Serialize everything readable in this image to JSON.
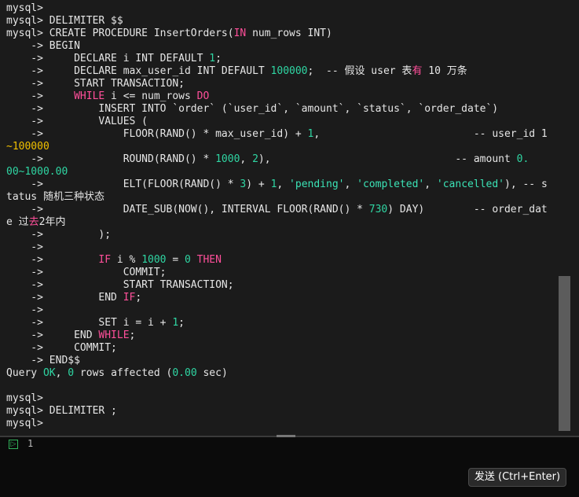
{
  "terminal": {
    "lines": [
      {
        "segments": [
          {
            "t": "mysql>",
            "c": ""
          }
        ]
      },
      {
        "segments": [
          {
            "t": "mysql> DELIMITER $$",
            "c": ""
          }
        ]
      },
      {
        "segments": [
          {
            "t": "mysql> CREATE PROCEDURE InsertOrders(",
            "c": ""
          },
          {
            "t": "IN",
            "c": "kw"
          },
          {
            "t": " num_rows INT)",
            "c": ""
          }
        ]
      },
      {
        "segments": [
          {
            "t": "    -> BEGIN",
            "c": ""
          }
        ]
      },
      {
        "segments": [
          {
            "t": "    ->     DECLARE i INT DEFAULT ",
            "c": ""
          },
          {
            "t": "1",
            "c": "num"
          },
          {
            "t": ";",
            "c": ""
          }
        ]
      },
      {
        "segments": [
          {
            "t": "    ->     DECLARE max_user_id INT DEFAULT ",
            "c": ""
          },
          {
            "t": "100000",
            "c": "num"
          },
          {
            "t": ";  -- 假设 user 表",
            "c": ""
          },
          {
            "t": "有",
            "c": "kw"
          },
          {
            "t": " 10 万条",
            "c": ""
          }
        ]
      },
      {
        "segments": [
          {
            "t": "    ->     START TRANSACTION;",
            "c": ""
          }
        ]
      },
      {
        "segments": [
          {
            "t": "    ->     ",
            "c": ""
          },
          {
            "t": "WHILE",
            "c": "kw"
          },
          {
            "t": " i <= num_rows ",
            "c": ""
          },
          {
            "t": "DO",
            "c": "kw"
          }
        ]
      },
      {
        "segments": [
          {
            "t": "    ->         INSERT INTO `order` (`user_id`, `amount`, `status`, `order_date`)",
            "c": ""
          }
        ]
      },
      {
        "segments": [
          {
            "t": "    ->         VALUES (",
            "c": ""
          }
        ]
      },
      {
        "segments": [
          {
            "t": "    ->             FLOOR(RAND() * max_user_id) + ",
            "c": ""
          },
          {
            "t": "1",
            "c": "num"
          },
          {
            "t": ",                         -- user_id 1",
            "c": ""
          }
        ]
      },
      {
        "segments": [
          {
            "t": "~100000",
            "c": "yel"
          }
        ]
      },
      {
        "segments": [
          {
            "t": "    ->             ROUND(RAND() * ",
            "c": ""
          },
          {
            "t": "1000",
            "c": "num"
          },
          {
            "t": ", ",
            "c": ""
          },
          {
            "t": "2",
            "c": "num"
          },
          {
            "t": "),                              -- amount ",
            "c": ""
          },
          {
            "t": "0.",
            "c": "num"
          }
        ]
      },
      {
        "segments": [
          {
            "t": "00~1000.00",
            "c": "num"
          }
        ]
      },
      {
        "segments": [
          {
            "t": "    ->             ELT(FLOOR(RAND() * ",
            "c": ""
          },
          {
            "t": "3",
            "c": "num"
          },
          {
            "t": ") + ",
            "c": ""
          },
          {
            "t": "1",
            "c": "num"
          },
          {
            "t": ", ",
            "c": ""
          },
          {
            "t": "'pending'",
            "c": "str"
          },
          {
            "t": ", ",
            "c": ""
          },
          {
            "t": "'completed'",
            "c": "str"
          },
          {
            "t": ", ",
            "c": ""
          },
          {
            "t": "'cancelled'",
            "c": "str"
          },
          {
            "t": "), -- s",
            "c": ""
          }
        ]
      },
      {
        "segments": [
          {
            "t": "tatus 随机三种状态",
            "c": ""
          }
        ]
      },
      {
        "segments": [
          {
            "t": "    ->             DATE_SUB(NOW(), INTERVAL FLOOR(RAND() * ",
            "c": ""
          },
          {
            "t": "730",
            "c": "num"
          },
          {
            "t": ") DAY)        -- order_dat",
            "c": ""
          }
        ]
      },
      {
        "segments": [
          {
            "t": "e 过",
            "c": ""
          },
          {
            "t": "去",
            "c": "kw"
          },
          {
            "t": "2年内",
            "c": ""
          }
        ]
      },
      {
        "segments": [
          {
            "t": "    ->         );",
            "c": ""
          }
        ]
      },
      {
        "segments": [
          {
            "t": "    ->",
            "c": ""
          }
        ]
      },
      {
        "segments": [
          {
            "t": "    ->         ",
            "c": ""
          },
          {
            "t": "IF",
            "c": "kw"
          },
          {
            "t": " i % ",
            "c": ""
          },
          {
            "t": "1000",
            "c": "num"
          },
          {
            "t": " = ",
            "c": ""
          },
          {
            "t": "0",
            "c": "num"
          },
          {
            "t": " ",
            "c": ""
          },
          {
            "t": "THEN",
            "c": "kw"
          }
        ]
      },
      {
        "segments": [
          {
            "t": "    ->             COMMIT;",
            "c": ""
          }
        ]
      },
      {
        "segments": [
          {
            "t": "    ->             START TRANSACTION;",
            "c": ""
          }
        ]
      },
      {
        "segments": [
          {
            "t": "    ->         END ",
            "c": ""
          },
          {
            "t": "IF",
            "c": "kw"
          },
          {
            "t": ";",
            "c": ""
          }
        ]
      },
      {
        "segments": [
          {
            "t": "    ->",
            "c": ""
          }
        ]
      },
      {
        "segments": [
          {
            "t": "    ->         SET i = i + ",
            "c": ""
          },
          {
            "t": "1",
            "c": "num"
          },
          {
            "t": ";",
            "c": ""
          }
        ]
      },
      {
        "segments": [
          {
            "t": "    ->     END ",
            "c": ""
          },
          {
            "t": "WHILE",
            "c": "kw"
          },
          {
            "t": ";",
            "c": ""
          }
        ]
      },
      {
        "segments": [
          {
            "t": "    ->     COMMIT;",
            "c": ""
          }
        ]
      },
      {
        "segments": [
          {
            "t": "    -> END$$",
            "c": ""
          }
        ]
      },
      {
        "segments": [
          {
            "t": "Query ",
            "c": ""
          },
          {
            "t": "OK",
            "c": "num"
          },
          {
            "t": ", ",
            "c": ""
          },
          {
            "t": "0",
            "c": "num"
          },
          {
            "t": " rows affected (",
            "c": ""
          },
          {
            "t": "0.00",
            "c": "num"
          },
          {
            "t": " sec)",
            "c": ""
          }
        ]
      },
      {
        "segments": [
          {
            "t": "",
            "c": ""
          }
        ]
      },
      {
        "segments": [
          {
            "t": "mysql>",
            "c": ""
          }
        ]
      },
      {
        "segments": [
          {
            "t": "mysql> DELIMITER ;",
            "c": ""
          }
        ]
      },
      {
        "segments": [
          {
            "t": "mysql>",
            "c": ""
          }
        ]
      }
    ]
  },
  "input": {
    "icon": "terminal-prompt-icon",
    "icon_glyph": "▷",
    "line_number": "1"
  },
  "send_button": {
    "label": "发送 (Ctrl+Enter)"
  },
  "colors": {
    "keyword": "#ff4f9a",
    "number": "#2fd6a3",
    "string": "#3be3b6",
    "highlight": "#f0c000",
    "terminal_bg": "#1b1b1b"
  }
}
